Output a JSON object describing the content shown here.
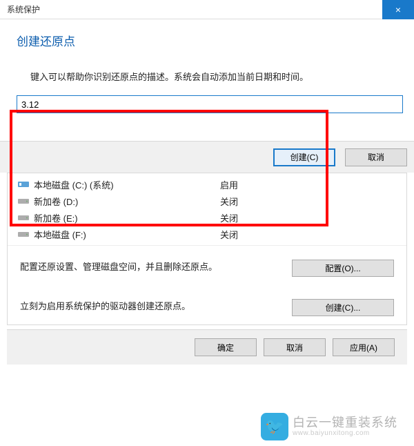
{
  "titlebar": {
    "title": "系统保护",
    "close": "×"
  },
  "dialog": {
    "heading": "创建还原点",
    "description": "键入可以帮助你识别还原点的描述。系统会自动添加当前日期和时间。",
    "input_value": "3.12",
    "create_btn": "创建(C)",
    "cancel_btn": "取消"
  },
  "drives": [
    {
      "name": "本地磁盘 (C:) (系统)",
      "status": "启用",
      "type": "system"
    },
    {
      "name": "新加卷 (D:)",
      "status": "关闭",
      "type": "hdd"
    },
    {
      "name": "新加卷 (E:)",
      "status": "关闭",
      "type": "hdd"
    },
    {
      "name": "本地磁盘 (F:)",
      "status": "关闭",
      "type": "hdd"
    }
  ],
  "config": {
    "desc1": "配置还原设置、管理磁盘空间，并且删除还原点。",
    "btn1": "配置(O)...",
    "desc2": "立刻为启用系统保护的驱动器创建还原点。",
    "btn2": "创建(C)..."
  },
  "bottom": {
    "ok": "确定",
    "cancel": "取消",
    "apply": "应用(A)"
  },
  "watermark": {
    "main": "白云一键重装系统",
    "sub": "www.baiyunxitong.com"
  }
}
